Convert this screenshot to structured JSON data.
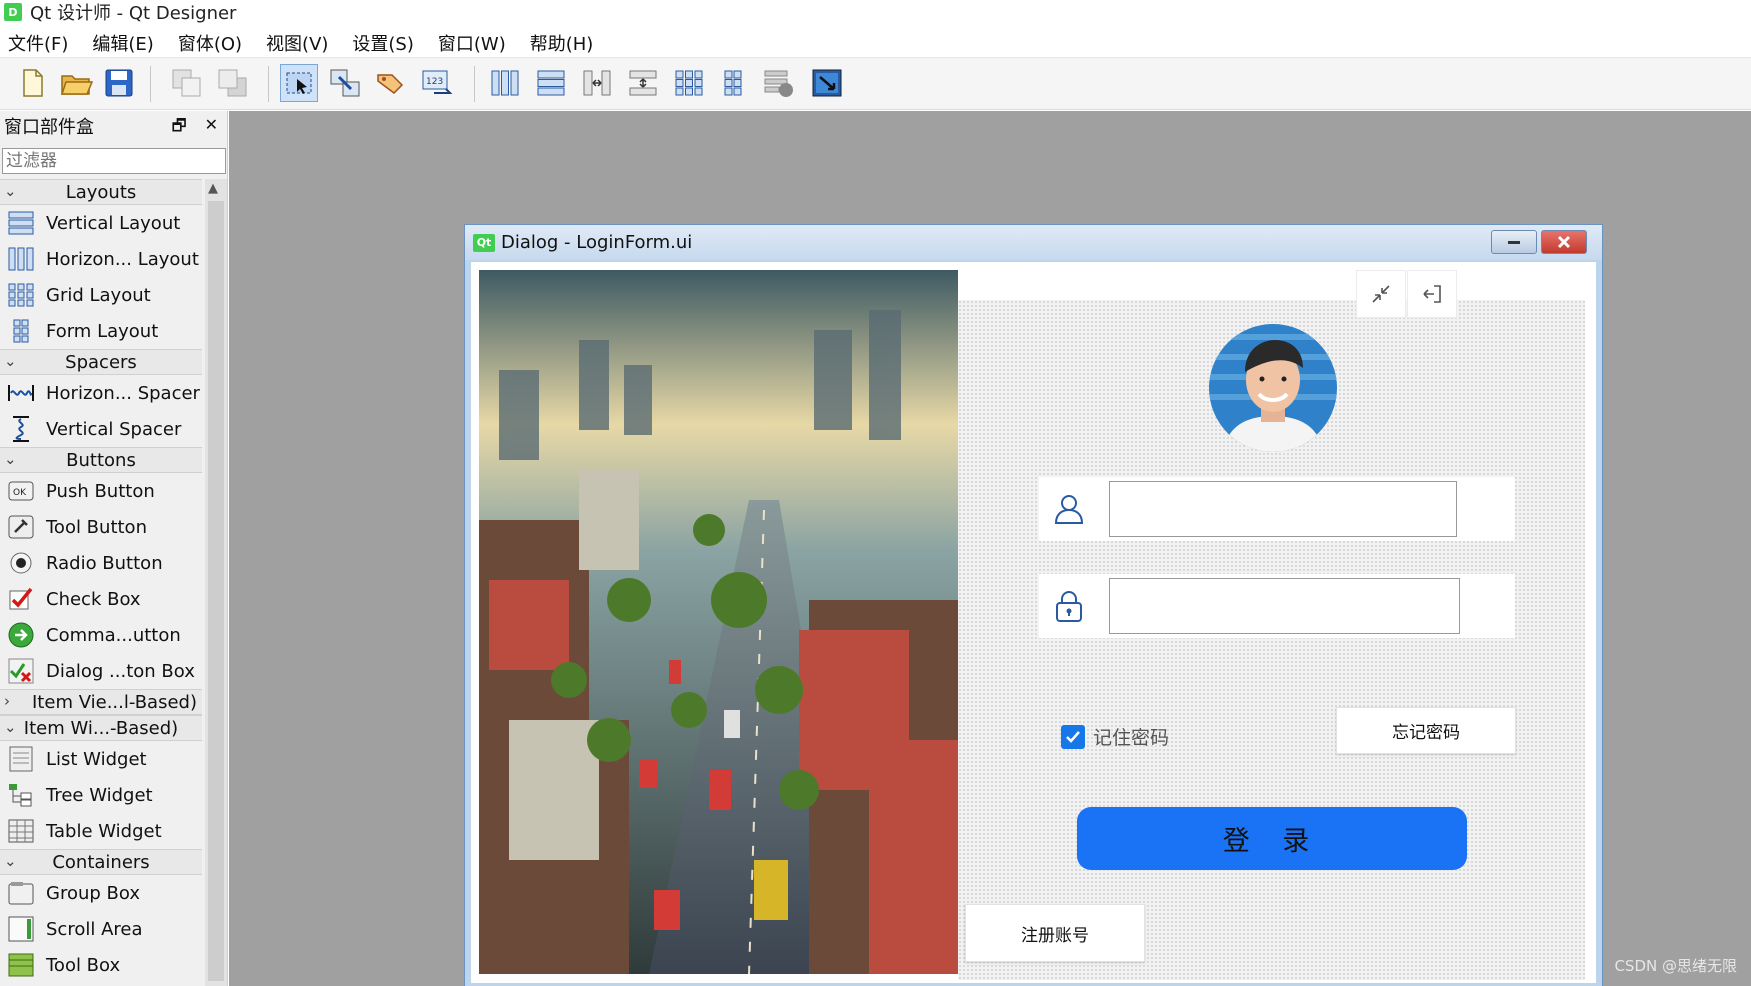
{
  "window": {
    "title": "Qt 设计师 - Qt Designer"
  },
  "menu": [
    {
      "label": "文件(F)"
    },
    {
      "label": "编辑(E)"
    },
    {
      "label": "窗体(O)"
    },
    {
      "label": "视图(V)"
    },
    {
      "label": "设置(S)"
    },
    {
      "label": "窗口(W)"
    },
    {
      "label": "帮助(H)"
    }
  ],
  "toolbar": {
    "buttons": [
      {
        "name": "new-form",
        "icon": "new-file-icon"
      },
      {
        "name": "open-form",
        "icon": "open-folder-icon"
      },
      {
        "name": "save-form",
        "icon": "save-disk-icon"
      },
      {
        "name": "bring-to-front",
        "icon": "bring-front-icon"
      },
      {
        "name": "send-to-back",
        "icon": "send-back-icon"
      },
      {
        "name": "edit-widgets",
        "icon": "edit-widgets-icon",
        "active": true
      },
      {
        "name": "edit-signals-slots",
        "icon": "signals-slots-icon"
      },
      {
        "name": "edit-buddies",
        "icon": "buddy-tag-icon"
      },
      {
        "name": "edit-tab-order",
        "icon": "tab-order-icon"
      },
      {
        "name": "lay-out-horizontally",
        "icon": "horizontal-layout-icon"
      },
      {
        "name": "lay-out-vertically",
        "icon": "vertical-layout-icon"
      },
      {
        "name": "lay-out-horizontally-splitter",
        "icon": "h-splitter-icon"
      },
      {
        "name": "lay-out-vertically-splitter",
        "icon": "v-splitter-icon"
      },
      {
        "name": "lay-out-grid",
        "icon": "grid-layout-icon"
      },
      {
        "name": "lay-out-form",
        "icon": "form-layout-icon"
      },
      {
        "name": "break-layout",
        "icon": "break-layout-icon"
      },
      {
        "name": "adjust-size",
        "icon": "adjust-size-icon"
      }
    ]
  },
  "widgetbox": {
    "title": "窗口部件盒",
    "filter_placeholder": "过滤器",
    "categories": [
      {
        "label": "Layouts",
        "expanded": true,
        "items": [
          {
            "label": "Vertical Layout",
            "icon": "vertical-layout-icon"
          },
          {
            "label": "Horizon... Layout",
            "icon": "horizontal-layout-icon"
          },
          {
            "label": "Grid Layout",
            "icon": "grid-layout-icon"
          },
          {
            "label": "Form Layout",
            "icon": "form-layout-icon"
          }
        ]
      },
      {
        "label": "Spacers",
        "expanded": true,
        "items": [
          {
            "label": "Horizon... Spacer",
            "icon": "horizontal-spacer-icon"
          },
          {
            "label": "Vertical Spacer",
            "icon": "vertical-spacer-icon"
          }
        ]
      },
      {
        "label": "Buttons",
        "expanded": true,
        "items": [
          {
            "label": "Push Button",
            "icon": "push-button-icon"
          },
          {
            "label": "Tool Button",
            "icon": "tool-button-icon"
          },
          {
            "label": "Radio Button",
            "icon": "radio-button-icon"
          },
          {
            "label": "Check Box",
            "icon": "check-box-icon"
          },
          {
            "label": "Comma...utton",
            "icon": "command-link-icon"
          },
          {
            "label": "Dialog ...ton Box",
            "icon": "dialog-button-box-icon"
          }
        ]
      },
      {
        "label": "Item Vie...l-Based)",
        "expanded": false,
        "items": []
      },
      {
        "label": "Item Wi...-Based)",
        "expanded": true,
        "items": [
          {
            "label": "List Widget",
            "icon": "list-widget-icon"
          },
          {
            "label": "Tree Widget",
            "icon": "tree-widget-icon"
          },
          {
            "label": "Table Widget",
            "icon": "table-widget-icon"
          }
        ]
      },
      {
        "label": "Containers",
        "expanded": true,
        "items": [
          {
            "label": "Group Box",
            "icon": "group-box-icon"
          },
          {
            "label": "Scroll Area",
            "icon": "scroll-area-icon"
          },
          {
            "label": "Tool Box",
            "icon": "tool-box-icon"
          }
        ]
      }
    ]
  },
  "dialog": {
    "title": "Dialog - LoginForm.ui",
    "username_value": "",
    "password_value": "",
    "remember_label": "记住密码",
    "remember_checked": true,
    "forgot_label": "忘记密码",
    "login_label": "登 录",
    "register_label": "注册账号",
    "accent_color": "#1a73f5"
  },
  "watermark": "CSDN @思绪无限"
}
